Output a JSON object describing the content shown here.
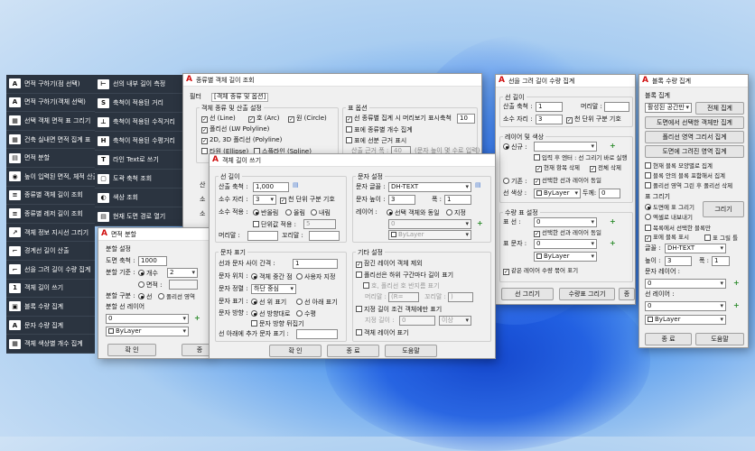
{
  "tiles_left": [
    {
      "label": "면적 구하기(점 선택)",
      "icon": "A"
    },
    {
      "label": "면적 구하기(객체 선택)",
      "icon": "A"
    },
    {
      "label": "선택 객체 면적 표 그리기",
      "icon": "▦"
    },
    {
      "label": "건축 실내면 면적 집계 표",
      "icon": "▦"
    },
    {
      "label": "면적 분할",
      "icon": "▤"
    },
    {
      "label": "높이 입력된 면적, 체적 산출",
      "icon": "◉"
    },
    {
      "label": "종류별 객체 길이 조회",
      "icon": "≡"
    },
    {
      "label": "종류별 레저 길이 조회",
      "icon": "≡"
    },
    {
      "label": "객체 정보 지시선 그리기",
      "icon": "↗"
    },
    {
      "label": "경계선 길이 산출",
      "icon": "⌐"
    },
    {
      "label": "선을 그려 길이 수량 집계",
      "icon": "⌐"
    },
    {
      "label": "객체 길이 쓰기",
      "icon": "1"
    },
    {
      "label": "블록 수량 집계",
      "icon": "▣"
    },
    {
      "label": "문자 수량 집계",
      "icon": "A"
    },
    {
      "label": "객체 색상별 개수 집계",
      "icon": "▦"
    }
  ],
  "tiles_right": [
    {
      "label": "선의 내부 길이 측정",
      "icon": "⊢"
    },
    {
      "label": "축척이 적용된 거리",
      "icon": "S"
    },
    {
      "label": "축척이 적용된 수직거리",
      "icon": "⊥"
    },
    {
      "label": "축척이 적용된 수평거리",
      "icon": "H"
    },
    {
      "label": "라인 Text로 쓰기",
      "icon": "T"
    },
    {
      "label": "도곽 축척 조회",
      "icon": "▢"
    },
    {
      "label": "색상 조회",
      "icon": "◐"
    },
    {
      "label": "현재 도면 경로 열기",
      "icon": "▤"
    }
  ],
  "dlg_typelen": {
    "title": "종류별 객체 길이 조회",
    "filter": "필터",
    "filter_tab": "[객체 종류 및 옵션]",
    "grp_types": "객체 종류 및 산출 설정",
    "line": "선 (Line)",
    "arc": "호 (Arc)",
    "circle": "원 (Circle)",
    "lwpoly": "폴리선 (LW Polyline)",
    "poly2d": "2D, 3D 폴리선 (Polyline)",
    "ellipse": "타원 (Ellipse)",
    "spline": "스플라인 (Spline)",
    "grp_opts": "표 옵션",
    "opt1": "선 종류별 집계 시 머리보기 표시",
    "scale_lbl": "축척",
    "scale_val": "10",
    "opt2": "표에 종류별 개수 집계",
    "opt3": "표에 선분 근거 표시",
    "base_lbl": "산출 근거 폭 :",
    "base_val": "40",
    "base_note": "(문자 높이 몇 수로 입력)",
    "side1": "산",
    "side2": "소",
    "side3": "소"
  },
  "dlg_write": {
    "title": "객체 길이 쓰기",
    "grp_len": "선 길이",
    "calc_scale": "산출 축척 :",
    "calc_scale_val": "1,000",
    "decimals": "소수 자리 :",
    "decimals_val": "3",
    "thousands": "천 단위 구분 기호",
    "round": "소수 적용 :",
    "round_opts": [
      "반올림",
      "올림",
      "내림"
    ],
    "unit_apply": "단위값 적용 :",
    "unit_val": "5",
    "prefix": "머리말 :",
    "suffix": "꼬리말 :",
    "grp_text": "문자 설정",
    "style": "문자 글꼴 :",
    "style_val": "DH-TEXT",
    "height": "문자 높이 :",
    "height_val": "3",
    "width": "폭 :",
    "width_val": "1",
    "layer": "레이어 :",
    "layer_same": "선택 객체와 동일",
    "layer_spec": "지정",
    "layer_val": "0",
    "color_val": "ByLayer",
    "grp_textdisp": "문자 표기",
    "gap": "선과 문자 사이 간격 :",
    "gap_val": "1",
    "pos": "문자 위치 :",
    "pos_mid": "객체 중간 점",
    "pos_user": "사용자 지정",
    "align": "문자 정렬 :",
    "align_val": "하단 중심",
    "side": "문자 표기 :",
    "side_up": "선 위 표기",
    "side_down": "선 아래 표기",
    "dir": "문자 방향 :",
    "dir_line": "선 방향대로",
    "dir_horz": "수평",
    "dir_flip": "문자 방향 뒤집기",
    "under_text": "선 아래에 추가 문자 표기 :",
    "grp_other": "기타 설정",
    "o1": "잠긴 레이어 객체 제외",
    "o2": "폴리선은 하위 구간마다 길이 표기",
    "o3": "호, 폴리선 호 반지름 표기",
    "rad": "머리말 :",
    "rad_val": "(R=",
    "tail": "꼬리말 :",
    "tail_val": ")",
    "o4": "지정 길이 조건 객체에만 표기",
    "cond": "지정 길이 :",
    "cond_val": "0",
    "cond_unit": "이상",
    "o5": "객체 레이어 표기",
    "ok": "확 인",
    "end": "종 료",
    "help": "도움말"
  },
  "dlg_area": {
    "title": "면적 분할",
    "grp": "분할 설정",
    "scale": "도면 축척 :",
    "scale_val": "1000",
    "basis": "분할 기준 :",
    "by_count": "개수",
    "count_val": "2",
    "by_area": "면적 :",
    "type": "분할 구분 :",
    "t_line": "선",
    "t_poly": "폴리선 영역",
    "grp_layer": "분할 선 레이어",
    "layer_val": "0",
    "color_val": "ByLayer",
    "ok": "확 인",
    "end": "종"
  },
  "dlg_drawlen": {
    "title": "선을 그려 길이 수량 집계",
    "grp_len": "선 길이",
    "scale": "산출 축척 :",
    "scale_val": "1",
    "prefix": "머리말 :",
    "decimals": "소수 자리 :",
    "decimals_val": "3",
    "thousands": "천 단위 구분 기호",
    "grp_layer": "레이어 및 색상",
    "new": "신규 :",
    "skip": "입력 후 엔터 : 선 그리기 바로 실행",
    "cur_del": "현재 항목 삭제",
    "all_del": "전체 삭제",
    "exist": "기존 :",
    "same": "선택한 선과 레이어 동일",
    "color": "선 색상 :",
    "color_val": "ByLayer",
    "width": "두께:",
    "width_val": "0",
    "grp_table": "수량 표 설정",
    "tline": "표 선 :",
    "tline_val": "0",
    "ttext": "표 문자 :",
    "ttext_val": "0",
    "tcolor_val": "ByLayer",
    "same_layer": "같은 레이어 수량 묶어 표기",
    "same_layer2": "선택한 선과 레이어 동일",
    "draw": "선 그리기",
    "table": "수량표 그리기",
    "end": "종"
  },
  "dlg_block": {
    "title": "블록 수량 집계",
    "grp": "블록 집계",
    "space": "활성된 공간만",
    "all": "전체 집계",
    "b1": "도면에서 선택한 객체만 집계",
    "b2": "폴리선 영역 그리서 집계",
    "b3": "도면에 그려진 영역 집계",
    "c1": "현재 블록 모양별로 집계",
    "c2": "블록 안의 블록 포함해서 집계",
    "c3": "폴리선 영역 그린 후 폴리선 삭제",
    "grp_table": "표 그리기",
    "draw_pt": "도면에 표 그리기",
    "excel": "엑셀로 내보내기",
    "draw": "그리기",
    "name": "목록에서 선택한 블록만",
    "show": "표에 블록 표시",
    "frame": "표 그릴 틀",
    "font": "글꼴 :",
    "font_val": "DH-TEXT",
    "height": "높이 :",
    "height_val": "3",
    "w": "폭 :",
    "w_val": "1",
    "text_layer": "문자 레이어 :",
    "text_layer_val": "0",
    "line_layer": "선 레이어 :",
    "line_layer_val": "0",
    "color_val": "ByLayer",
    "end": "종 료",
    "help": "도움말"
  }
}
